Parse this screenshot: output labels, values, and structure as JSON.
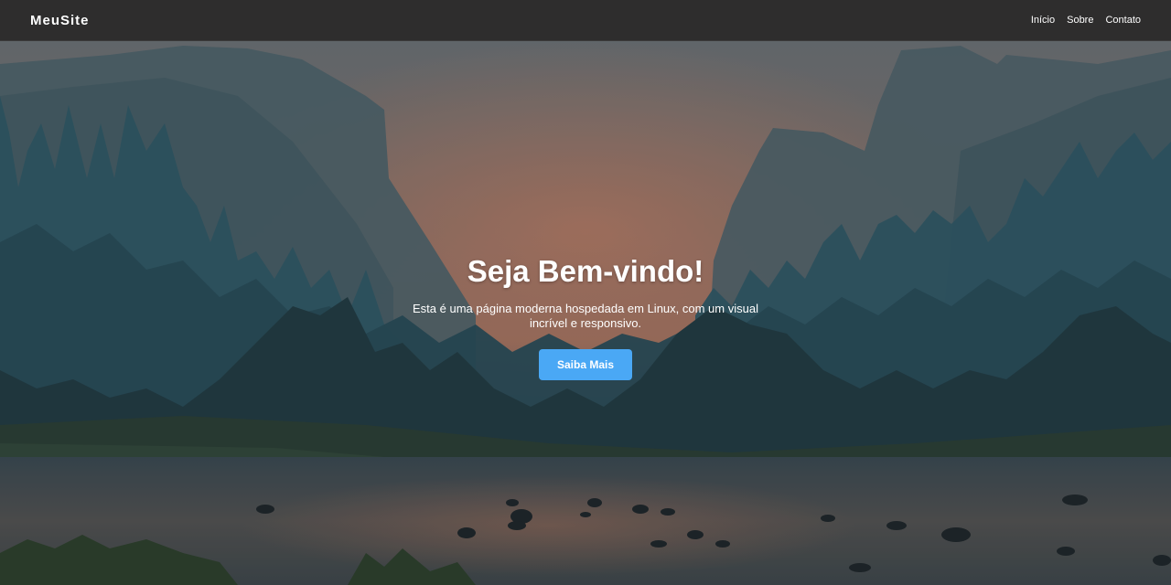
{
  "navbar": {
    "logo": "MeuSite",
    "links": [
      "Início",
      "Sobre",
      "Contato"
    ]
  },
  "hero": {
    "title": "Seja Bem-vindo!",
    "text": "Esta é uma página moderna hospedada em Linux, com um visual incrível e responsivo.",
    "button_label": "Saiba Mais",
    "background_description": "forest-valley-river-landscape"
  },
  "colors": {
    "navbar_bg": "#2e2d2d",
    "button_bg": "#4aa8f5",
    "text": "#ffffff"
  }
}
